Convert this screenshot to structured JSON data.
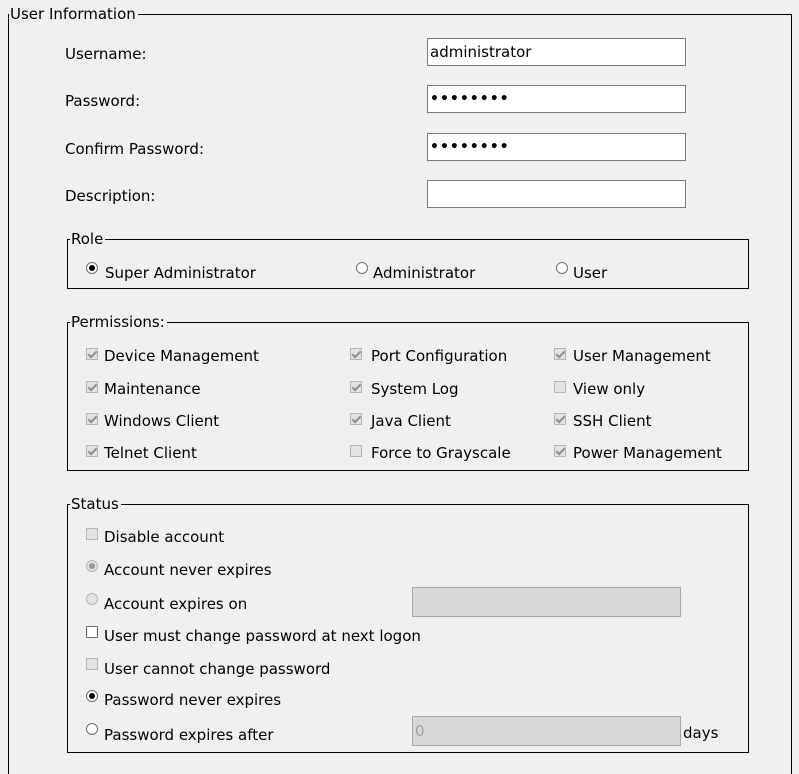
{
  "user_info": {
    "legend": "User Information",
    "username_label": "Username:",
    "username_value": "administrator",
    "password_label": "Password:",
    "password_value": "••••••••",
    "confirm_label": "Confirm Password:",
    "confirm_value": "••••••••",
    "description_label": "Description:",
    "description_value": ""
  },
  "role": {
    "legend": "Role",
    "options": [
      {
        "label": "Super Administrator",
        "selected": true
      },
      {
        "label": "Administrator",
        "selected": false
      },
      {
        "label": "User",
        "selected": false
      }
    ]
  },
  "permissions": {
    "legend": "Permissions:",
    "items": [
      {
        "label": "Device Management",
        "checked": true
      },
      {
        "label": "Port Configuration",
        "checked": true
      },
      {
        "label": "User Management",
        "checked": true
      },
      {
        "label": "Maintenance",
        "checked": true
      },
      {
        "label": "System Log",
        "checked": true
      },
      {
        "label": "View only",
        "checked": false
      },
      {
        "label": "Windows Client",
        "checked": true
      },
      {
        "label": "Java Client",
        "checked": true
      },
      {
        "label": "SSH Client",
        "checked": true
      },
      {
        "label": "Telnet Client",
        "checked": true
      },
      {
        "label": "Force to Grayscale",
        "checked": false
      },
      {
        "label": "Power Management",
        "checked": true
      }
    ]
  },
  "status": {
    "legend": "Status",
    "disable_account": {
      "label": "Disable account",
      "checked": false
    },
    "never_expires": {
      "label": "Account never expires",
      "selected": true
    },
    "expires_on": {
      "label": "Account expires on",
      "selected": false,
      "value": ""
    },
    "must_change": {
      "label": "User must change password at next logon",
      "checked": false
    },
    "cannot_change": {
      "label": "User cannot change password",
      "checked": false
    },
    "pw_never_expires": {
      "label": "Password never expires",
      "selected": true
    },
    "pw_expires_after": {
      "label": "Password expires after",
      "selected": false,
      "value": "0",
      "unit": "days"
    }
  }
}
